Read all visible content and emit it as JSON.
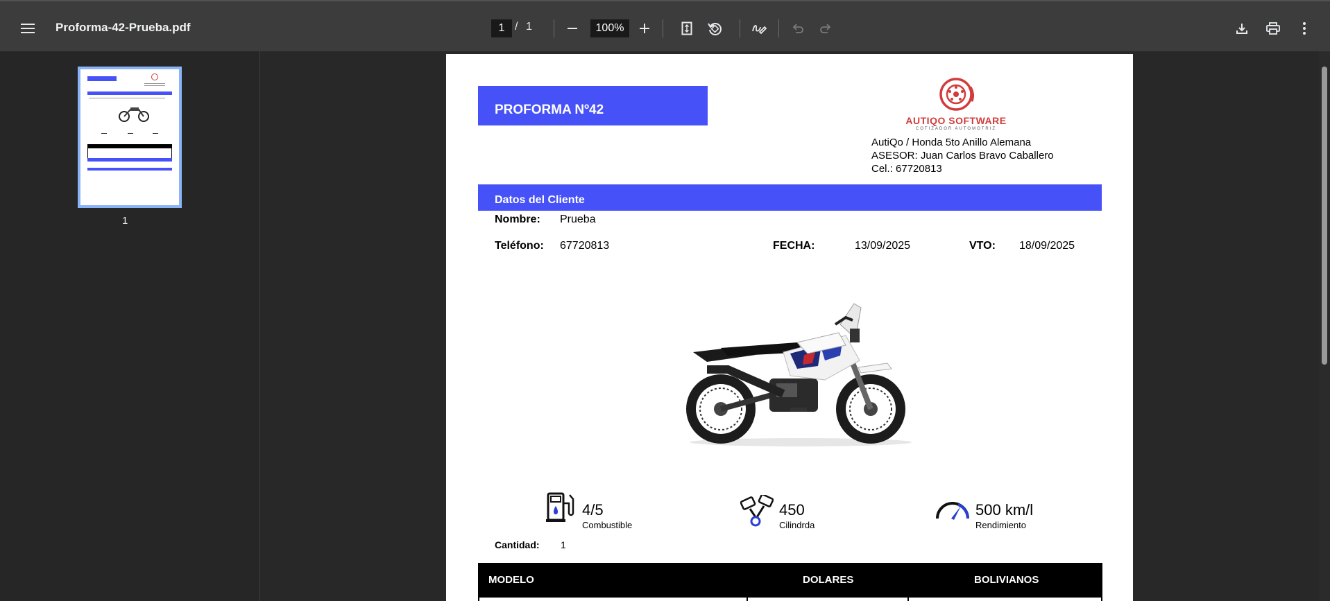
{
  "viewer": {
    "filename": "Proforma-42-Prueba.pdf",
    "current_page": "1",
    "page_separator": "/",
    "total_pages": "1",
    "zoom": "100%",
    "thumbnail_label": "1"
  },
  "document": {
    "proforma_title": "PROFORMA Nº42",
    "logo_name": "AUTIQO SOFTWARE",
    "logo_tagline": "COTIZADOR AUTOMOTRIZ",
    "company_line1": "AutiQo / Honda 5to Anillo Alemana",
    "company_line2": "ASESOR: Juan Carlos Bravo Caballero",
    "company_line3": "Cel.: 67720813",
    "client_section": "Datos del Cliente",
    "name_label": "Nombre:",
    "name_value": "Prueba",
    "phone_label": "Teléfono:",
    "phone_value": "67720813",
    "date_label": "FECHA:",
    "date_value": "13/09/2025",
    "due_label": "VTO:",
    "due_value": "18/09/2025",
    "specs": [
      {
        "value": "4/5",
        "label": "Combustible",
        "icon": "fuel-pump-icon"
      },
      {
        "value": "450",
        "label": "Cilindrda",
        "icon": "pistons-icon"
      },
      {
        "value": "500 km/l",
        "label": "Rendimiento",
        "icon": "speedometer-icon"
      }
    ],
    "qty_label": "Cantidad:",
    "qty_value": "1",
    "table_headers": [
      "MODELO",
      "DOLARES",
      "BOLIVIANOS"
    ]
  },
  "colors": {
    "accent": "#4651f8",
    "toolbar": "#3c3c3c",
    "background": "#282828",
    "logo_red": "#d23b3b"
  }
}
